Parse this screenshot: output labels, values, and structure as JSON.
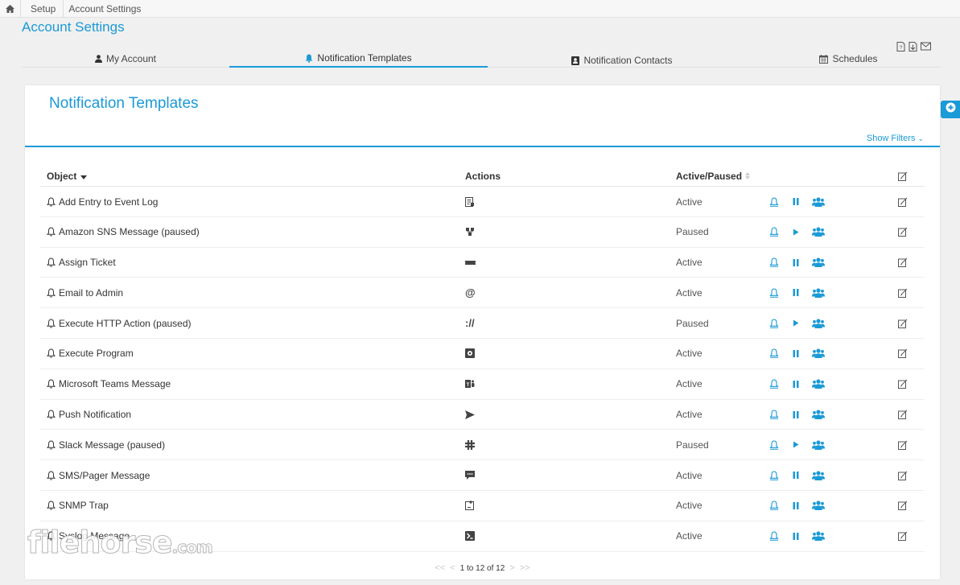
{
  "breadcrumb": {
    "items": [
      "Setup",
      "Account Settings"
    ]
  },
  "page_title": "Account Settings",
  "tabs": [
    {
      "label": "My Account",
      "icon": "user-icon"
    },
    {
      "label": "Notification Templates",
      "icon": "bell-icon",
      "active": true
    },
    {
      "label": "Notification Contacts",
      "icon": "contact-card-icon"
    },
    {
      "label": "Schedules",
      "icon": "calendar-icon"
    }
  ],
  "panel": {
    "title": "Notification Templates",
    "show_filters": "Show Filters"
  },
  "table": {
    "headers": {
      "object": "Object",
      "actions": "Actions",
      "status": "Active/Paused"
    },
    "rows": [
      {
        "name": "Add Entry to Event Log",
        "action_icon": "event-log-icon",
        "status": "Active"
      },
      {
        "name": "Amazon SNS Message (paused)",
        "action_icon": "sns-icon",
        "status": "Paused"
      },
      {
        "name": "Assign Ticket",
        "action_icon": "ticket-icon",
        "status": "Active"
      },
      {
        "name": "Email to Admin",
        "action_icon": "at-sign-icon",
        "action_text": "@",
        "status": "Active"
      },
      {
        "name": "Execute HTTP Action (paused)",
        "action_icon": "http-icon",
        "action_text": "://",
        "status": "Paused"
      },
      {
        "name": "Execute Program",
        "action_icon": "program-icon",
        "status": "Active"
      },
      {
        "name": "Microsoft Teams Message",
        "action_icon": "teams-icon",
        "status": "Active"
      },
      {
        "name": "Push Notification",
        "action_icon": "send-icon",
        "status": "Active"
      },
      {
        "name": "Slack Message (paused)",
        "action_icon": "slack-icon",
        "status": "Paused"
      },
      {
        "name": "SMS/Pager Message",
        "action_icon": "sms-icon",
        "status": "Active"
      },
      {
        "name": "SNMP Trap",
        "action_icon": "snmp-icon",
        "status": "Active"
      },
      {
        "name": "Syslog Message",
        "action_icon": "syslog-icon",
        "status": "Active"
      }
    ]
  },
  "pager": {
    "first": "<<",
    "prev": "<",
    "range": "1 to 12 of 12",
    "next": ">",
    "last": ">>"
  },
  "watermark": {
    "main": "filehorse",
    "suffix": ".com"
  },
  "colors": {
    "accent": "#1a9ad6",
    "text": "#333333",
    "background": "#f0f0f0"
  }
}
